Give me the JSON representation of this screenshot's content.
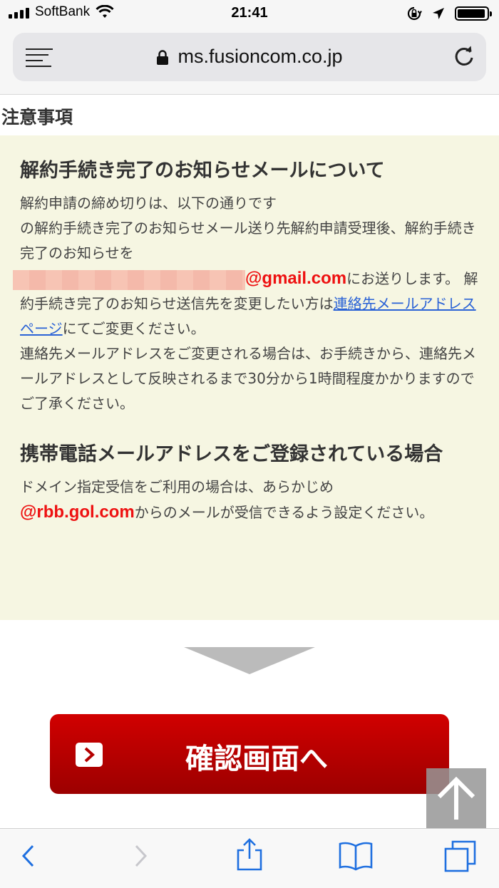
{
  "status_bar": {
    "carrier": "SoftBank",
    "time": "21:41"
  },
  "browser": {
    "url": "ms.fusioncom.co.jp"
  },
  "page": {
    "section_title": "注意事項",
    "notice": {
      "heading1": "解約手続き完了のお知らせメールについて",
      "para1_line1": "解約申請の締め切りは、以下の通りです",
      "para1_line2": "の解約手続き完了のお知らせメール送り先解約申請受理後、解約手続き完了のお知らせを",
      "email_domain": "@gmail.com",
      "para1_after_email": "にお送りします。 解約手続き完了のお知らせ送信先を変更したい方は",
      "contact_link": "連絡先メールアドレスページ",
      "para1_after_link": "にてご変更ください。",
      "para1_rest": "連絡先メールアドレスをご変更される場合は、お手続きから、連絡先メールアドレスとして反映されるまで30分から1時間程度かかりますのでご了承ください。",
      "heading2": "携帯電話メールアドレスをご登録されている場合",
      "para2_line1": "ドメイン指定受信をご利用の場合は、あらかじめ",
      "domain": "@rbb.gol.com",
      "para2_after_domain": "からのメールが受信できるよう設定ください。"
    },
    "confirm_button": "確認画面へ"
  },
  "colors": {
    "button_red": "#c00000",
    "notice_bg": "#f6f6e2",
    "link": "#2a62d6",
    "email_red": "#ee1111"
  }
}
